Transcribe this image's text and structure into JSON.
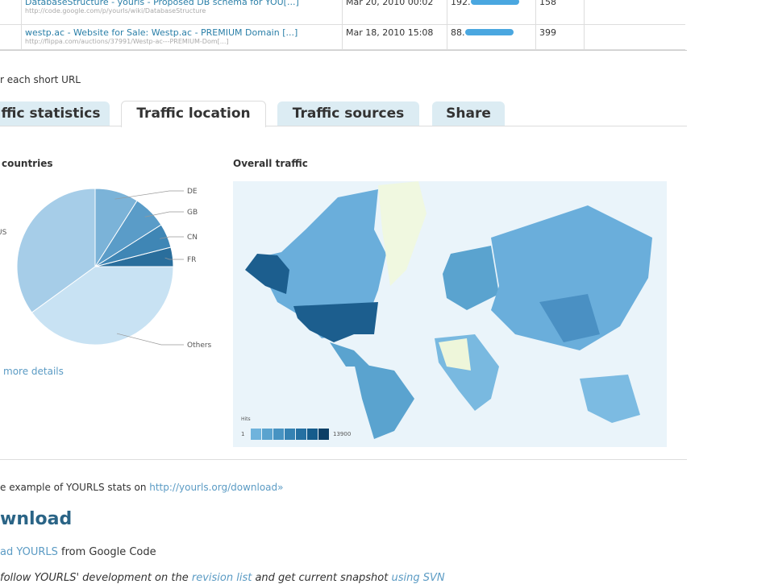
{
  "table": {
    "rows": [
      {
        "title": "DatabaseStructure - yourls - Proposed DB schema for YOU[...]",
        "url": "http://code.google.com/p/yourls/wiki/DatabaseStructure",
        "date": "Mar 20, 2010 00:02",
        "ip": "192.",
        "clicks": "158"
      },
      {
        "title": "westp.ac - Website for Sale: Westp.ac - PREMIUM Domain [...]",
        "url": "http://flippa.com/auctions/37991/Westp-ac---PREMIUM-Dom[...]",
        "date": "Mar 18, 2010 15:08",
        "ip": "88.",
        "clicks": "399"
      }
    ]
  },
  "caption": "r each short URL",
  "tabs": [
    {
      "label": "ffic statistics"
    },
    {
      "label": "Traffic location"
    },
    {
      "label": "Traffic sources"
    },
    {
      "label": "Share"
    }
  ],
  "left_heading": "countries",
  "right_heading": "Overall traffic",
  "more_details": "more details",
  "map_legend": {
    "title": "Hits",
    "min": "1",
    "max": "13900",
    "colors": [
      "#6fb3dc",
      "#5aa3cf",
      "#4793c2",
      "#3582b3",
      "#2570a2",
      "#155c8c",
      "#0b3f66"
    ]
  },
  "chart_data": {
    "type": "pie",
    "title": "Top countries",
    "labels": [
      "FR",
      "CN",
      "GB",
      "DE",
      "US",
      "Others"
    ],
    "values": [
      4,
      5,
      7,
      9,
      35,
      40
    ],
    "colors": [
      "#2a6e9c",
      "#3f86b5",
      "#5a9cc8",
      "#7bb3d8",
      "#a6cde8",
      "#c8e2f3"
    ]
  },
  "footer": {
    "example_text": "e example of YOURLS stats on ",
    "example_link": "http://yourls.org/download»",
    "heading": "wnload",
    "dl_link": "ad YOURLS",
    "dl_text": " from Google Code",
    "follow_text": "follow YOURLS' development on the ",
    "revision_link": "revision list",
    "follow_text2": " and get current snapshot ",
    "svn_link": "using SVN"
  }
}
